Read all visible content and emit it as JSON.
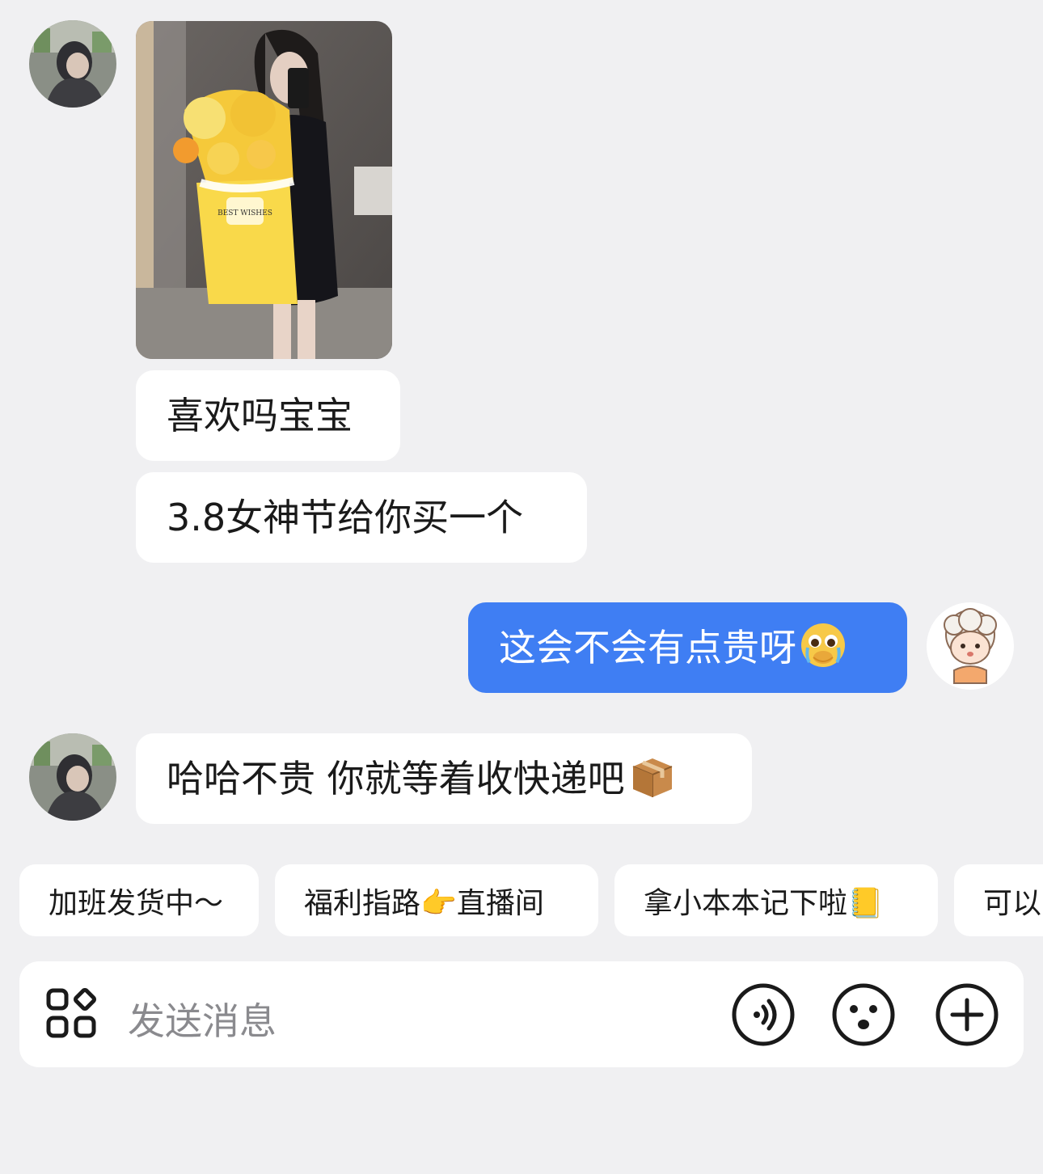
{
  "messages": [
    {
      "side": "incoming",
      "type": "image",
      "alt_caption": "BEST WISHES"
    },
    {
      "side": "incoming",
      "type": "text",
      "text": "喜欢吗宝宝"
    },
    {
      "side": "incoming",
      "type": "text",
      "text": "3.8女神节给你买一个"
    },
    {
      "side": "outgoing",
      "type": "text",
      "text": "这会不会有点贵呀",
      "emoji": "😢"
    },
    {
      "side": "incoming",
      "type": "text",
      "text": "哈哈不贵 你就等着收快递吧",
      "emoji": "📦"
    }
  ],
  "quick_replies": [
    "加班发货中～",
    "福利指路👉直播间",
    "拿小本本记下啦📒",
    "可以"
  ],
  "composer": {
    "placeholder": "发送消息",
    "icons": [
      "apps-grid-icon",
      "voice-icon",
      "emoji-face-icon",
      "plus-icon"
    ]
  },
  "colors": {
    "background": "#f0f0f2",
    "incoming_bubble": "#ffffff",
    "outgoing_bubble": "#3f7ef3",
    "text": "#1a1a1a",
    "placeholder": "#8a8a8e"
  }
}
